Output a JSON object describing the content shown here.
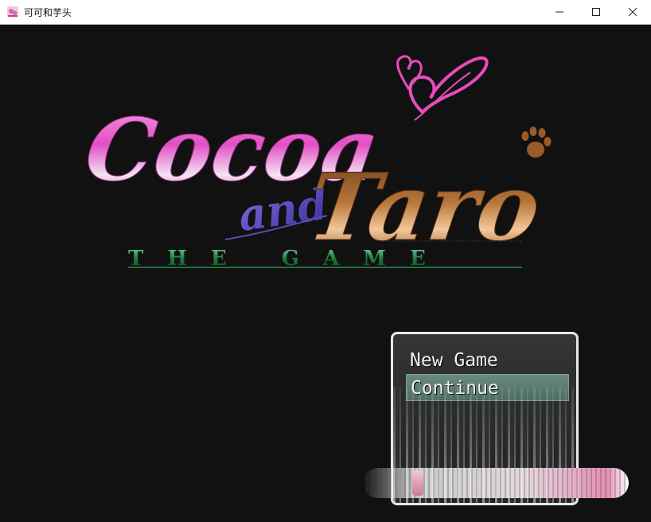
{
  "window": {
    "title": "可可和芋头",
    "controls": {
      "minimize_icon": "minimize-icon",
      "maximize_icon": "maximize-icon",
      "close_icon": "close-icon"
    }
  },
  "logo": {
    "word_cocoa": "Cocoa",
    "word_and": "and",
    "word_taro": "Taro",
    "subtitle": "THE GAME",
    "colors": {
      "cocoa": "#e455c8",
      "and": "#5b4bbf",
      "taro": "#a0622a",
      "subtitle": "#2e8a4a",
      "heart": "#e64cbc",
      "paw": "#9a5a2a"
    }
  },
  "menu": {
    "items": [
      {
        "label": "New Game",
        "selected": false
      },
      {
        "label": "Continue",
        "selected": true
      },
      {
        "label": "",
        "selected": false
      }
    ]
  }
}
